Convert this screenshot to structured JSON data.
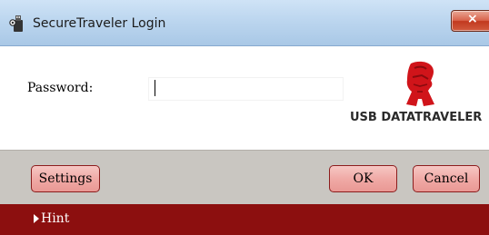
{
  "window": {
    "title": "SecureTraveler Login",
    "close_label": "×"
  },
  "login": {
    "password_label": "Password:",
    "password_value": ""
  },
  "logo": {
    "text": "USB DATATRAVELER"
  },
  "buttons": {
    "settings": "Settings",
    "ok": "OK",
    "cancel": "Cancel"
  },
  "hint": {
    "label": "Hint"
  },
  "colors": {
    "hint_bar": "#8c0f0f",
    "button_bar": "#c9c6c1",
    "button_fill": "#f0aaa6",
    "logo_red": "#d0141a"
  }
}
